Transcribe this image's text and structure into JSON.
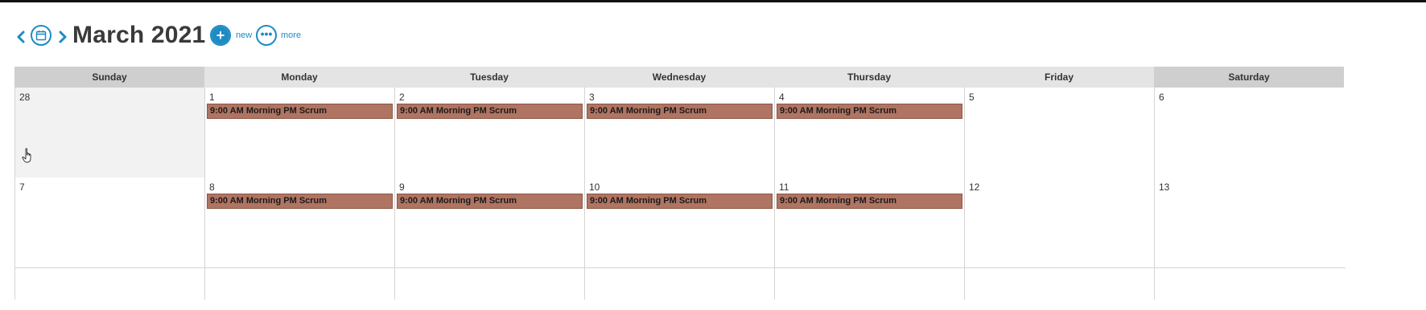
{
  "toolbar": {
    "title": "March 2021",
    "new_label": "new",
    "more_label": "more",
    "accent_color": "#1e8bc3"
  },
  "calendar": {
    "day_headers": [
      "Sunday",
      "Monday",
      "Tuesday",
      "Wednesday",
      "Thursday",
      "Friday",
      "Saturday"
    ],
    "event_color": "#b07462",
    "weeks": [
      {
        "days": [
          {
            "num": "28",
            "other_month": true,
            "event": ""
          },
          {
            "num": "1",
            "other_month": false,
            "event": "9:00 AM Morning PM Scrum"
          },
          {
            "num": "2",
            "other_month": false,
            "event": "9:00 AM Morning PM Scrum"
          },
          {
            "num": "3",
            "other_month": false,
            "event": "9:00 AM Morning PM Scrum"
          },
          {
            "num": "4",
            "other_month": false,
            "event": "9:00 AM Morning PM Scrum"
          },
          {
            "num": "5",
            "other_month": false,
            "event": ""
          },
          {
            "num": "6",
            "other_month": false,
            "event": ""
          }
        ]
      },
      {
        "days": [
          {
            "num": "7",
            "other_month": false,
            "event": ""
          },
          {
            "num": "8",
            "other_month": false,
            "event": "9:00 AM Morning PM Scrum"
          },
          {
            "num": "9",
            "other_month": false,
            "event": "9:00 AM Morning PM Scrum"
          },
          {
            "num": "10",
            "other_month": false,
            "event": "9:00 AM Morning PM Scrum"
          },
          {
            "num": "11",
            "other_month": false,
            "event": "9:00 AM Morning PM Scrum"
          },
          {
            "num": "12",
            "other_month": false,
            "event": ""
          },
          {
            "num": "13",
            "other_month": false,
            "event": ""
          }
        ]
      }
    ]
  }
}
